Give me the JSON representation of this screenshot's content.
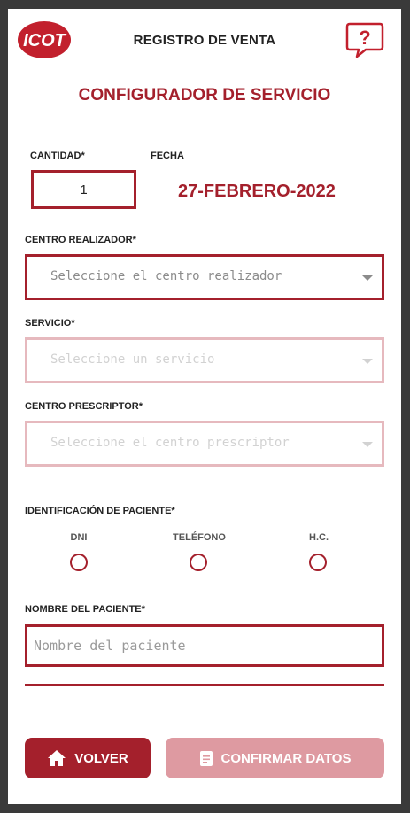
{
  "header": {
    "logo_text": "ICOT",
    "title": "REGISTRO DE VENTA",
    "help_icon": "question-bubble-icon"
  },
  "section_title": "CONFIGURADOR DE SERVICIO",
  "quantity": {
    "label": "CANTIDAD*",
    "value": "1"
  },
  "date": {
    "label": "FECHA",
    "value": "27-FEBRERO-2022"
  },
  "centro_realizador": {
    "label": "CENTRO REALIZADOR*",
    "placeholder": "Seleccione el centro realizador"
  },
  "servicio": {
    "label": "SERVICIO*",
    "placeholder": "Seleccione un servicio"
  },
  "centro_prescriptor": {
    "label": "CENTRO PRESCRIPTOR*",
    "placeholder": "Seleccione el centro prescriptor"
  },
  "identificacion": {
    "label": "IDENTIFICACIÓN DE PACIENTE*",
    "options": [
      "DNI",
      "TELÉFONO",
      "H.C."
    ]
  },
  "nombre": {
    "label": "NOMBRE DEL PACIENTE*",
    "placeholder": "Nombre del paciente"
  },
  "buttons": {
    "back_label": "VOLVER",
    "confirm_label": "CONFIRMAR DATOS"
  },
  "colors": {
    "brand": "#a4202c",
    "brand_disabled": "#de9aa1"
  }
}
